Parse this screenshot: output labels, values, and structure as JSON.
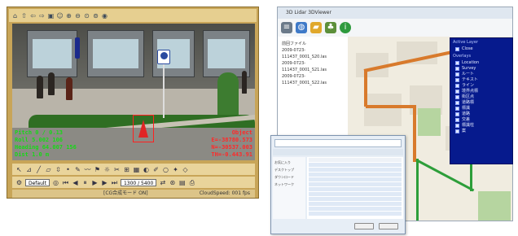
{
  "left_window": {
    "overlay_green": [
      "Pitch 0 / 0.13",
      "Roll 5.002 106",
      "Heading 64.007 156",
      "Dist 1.0 m"
    ],
    "overlay_red": [
      "Object",
      "E=-38780.573",
      "N=-30537.003",
      "TH=-0.443.91"
    ],
    "ctrl": {
      "mode_value": "Default",
      "frame_value": "1300 / 5400"
    },
    "status": {
      "left": "[CG合成モード ON]",
      "right": "CloudSpeed: 001 fps"
    }
  },
  "right_window": {
    "title": "3D Lidar 3DViewer",
    "files_header": "前回ファイル",
    "files": [
      "2009-0723-111437_0001_S20.las",
      "2009-0723-111437_0001_S21.las",
      "2009-0723-111437_0001_S22.las"
    ],
    "layer_panel": {
      "header": "Active Layer",
      "subheader": "Close",
      "section": "Overlays",
      "items": [
        "Location",
        "Survey",
        "ルート",
        "テキスト",
        "ライン",
        "境界点標",
        "街区点",
        "道路標",
        "標識",
        "道路",
        "交差",
        "標識柱",
        "案"
      ]
    }
  },
  "file_dialog": {
    "nav": [
      "お気に入り",
      "デスクトップ",
      "ダウンロード",
      "ネットワーク"
    ],
    "ok_label": "",
    "cancel_label": ""
  },
  "colors": {
    "left_frame": "#c8a558",
    "layer_panel_bg": "#061a8d",
    "route_orange": "#d87a2c",
    "route_green": "#2d9e3a",
    "overlay_green": "#18d818",
    "overlay_red": "#ff2a2a"
  }
}
